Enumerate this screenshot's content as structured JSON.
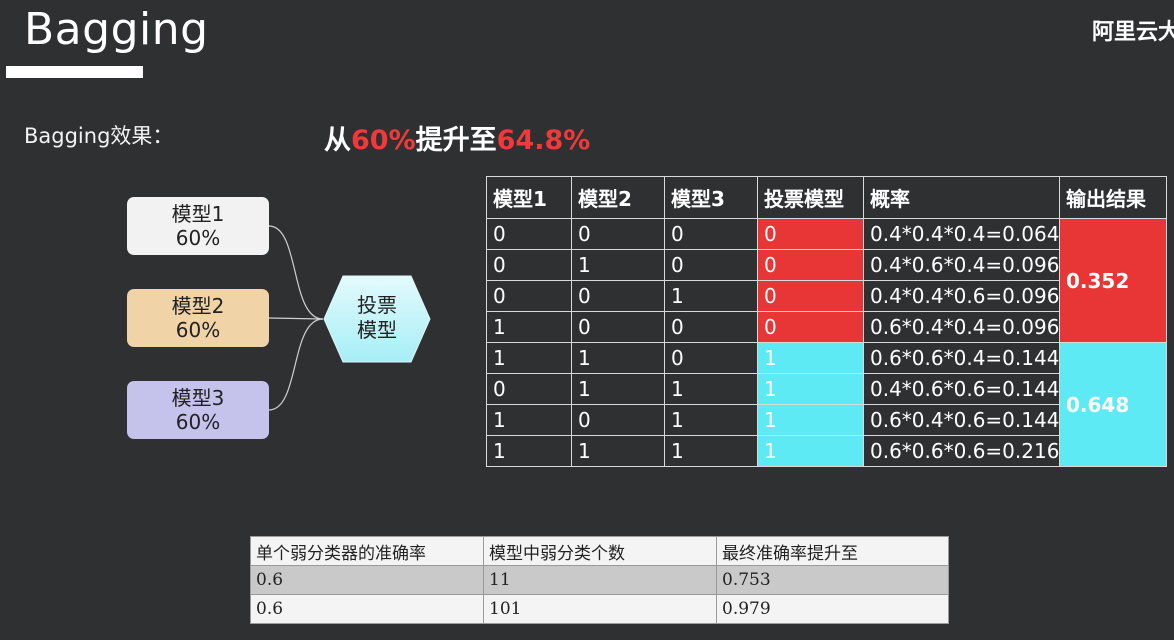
{
  "title": "Bagging",
  "brand": "阿里云大",
  "effect_label": "Bagging效果：",
  "headline": {
    "prefix": "从",
    "from": "60%",
    "middle": "提升至",
    "to": "64.8%"
  },
  "diagram": {
    "models": [
      {
        "name": "模型1",
        "accuracy": "60%",
        "color": "#f2f2f2"
      },
      {
        "name": "模型2",
        "accuracy": "60%",
        "color": "#f0d3a6"
      },
      {
        "name": "模型3",
        "accuracy": "60%",
        "color": "#c5c3ec"
      }
    ],
    "vote_line1": "投票",
    "vote_line2": "模型",
    "vote_color": "#c9f5fa"
  },
  "main_table": {
    "headers": [
      "模型1",
      "模型2",
      "模型3",
      "投票模型",
      "概率",
      "输出结果"
    ],
    "rows": [
      [
        "0",
        "0",
        "0",
        "0",
        "0.4*0.4*0.4=0.064"
      ],
      [
        "0",
        "1",
        "0",
        "0",
        "0.4*0.6*0.4=0.096"
      ],
      [
        "0",
        "0",
        "1",
        "0",
        "0.4*0.4*0.6=0.096"
      ],
      [
        "1",
        "0",
        "0",
        "0",
        "0.6*0.4*0.4=0.096"
      ],
      [
        "1",
        "1",
        "0",
        "1",
        "0.6*0.6*0.4=0.144"
      ],
      [
        "0",
        "1",
        "1",
        "1",
        "0.4*0.6*0.6=0.144"
      ],
      [
        "1",
        "0",
        "1",
        "1",
        "0.6*0.4*0.6=0.144"
      ],
      [
        "1",
        "1",
        "1",
        "1",
        "0.6*0.6*0.6=0.216"
      ]
    ],
    "output_red": "0.352",
    "output_cyan": "0.648",
    "colors": {
      "red": "#e83535",
      "cyan": "#5eeaf4"
    }
  },
  "bottom_table": {
    "headers": [
      "单个弱分类器的准确率",
      "模型中弱分类个数",
      "最终准确率提升至"
    ],
    "rows": [
      [
        "0.6",
        "11",
        "0.753"
      ],
      [
        "0.6",
        "101",
        "0.979"
      ]
    ]
  }
}
